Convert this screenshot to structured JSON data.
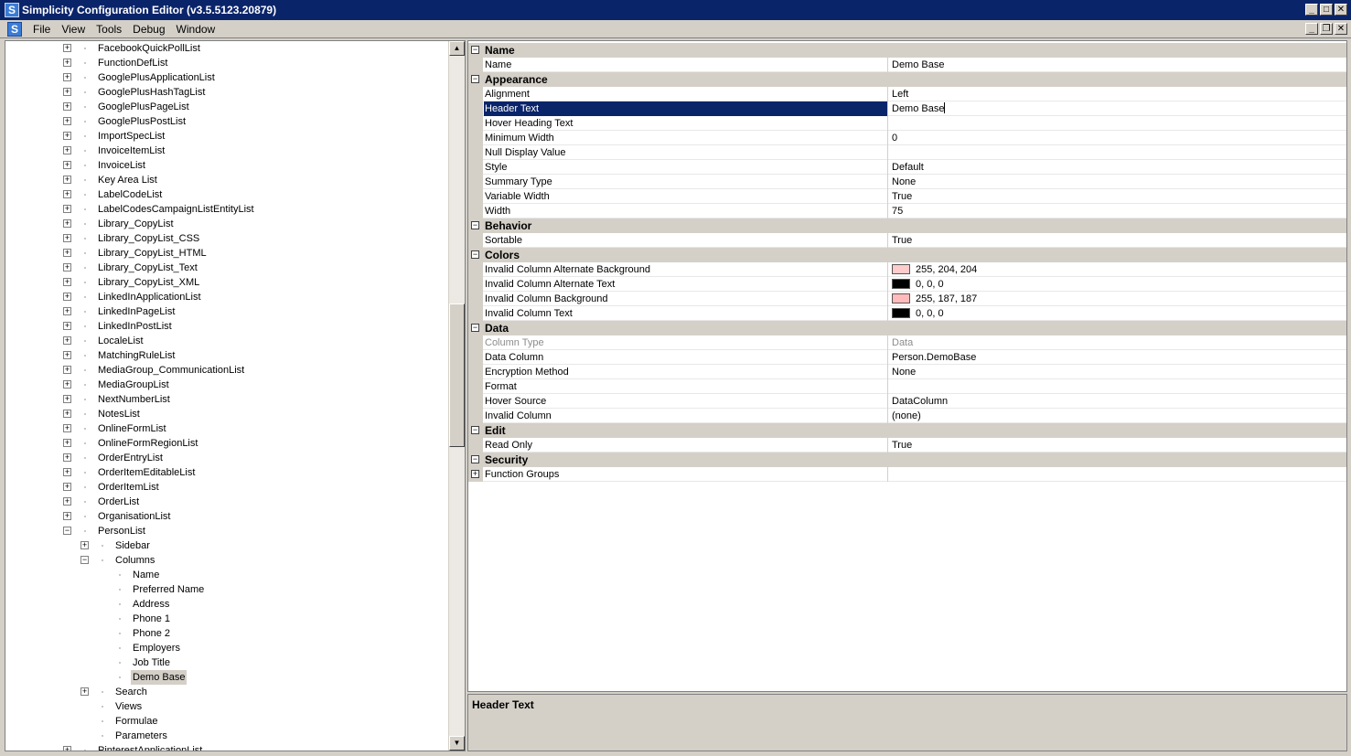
{
  "window": {
    "title": "Simplicity Configuration Editor (v3.5.5123.20879)",
    "app_icon_glyph": "S",
    "controls": [
      "_",
      "□",
      "✕"
    ]
  },
  "menubar": {
    "items": [
      "File",
      "View",
      "Tools",
      "Debug",
      "Window"
    ],
    "mdi_controls": [
      "_",
      "❐",
      "✕"
    ]
  },
  "tree": {
    "items": [
      {
        "label": "FacebookQuickPollList",
        "level": 0,
        "expander": "+"
      },
      {
        "label": "FunctionDefList",
        "level": 0,
        "expander": "+"
      },
      {
        "label": "GooglePlusApplicationList",
        "level": 0,
        "expander": "+"
      },
      {
        "label": "GooglePlusHashTagList",
        "level": 0,
        "expander": "+"
      },
      {
        "label": "GooglePlusPageList",
        "level": 0,
        "expander": "+"
      },
      {
        "label": "GooglePlusPostList",
        "level": 0,
        "expander": "+"
      },
      {
        "label": "ImportSpecList",
        "level": 0,
        "expander": "+"
      },
      {
        "label": "InvoiceItemList",
        "level": 0,
        "expander": "+"
      },
      {
        "label": "InvoiceList",
        "level": 0,
        "expander": "+"
      },
      {
        "label": "Key Area List",
        "level": 0,
        "expander": "+"
      },
      {
        "label": "LabelCodeList",
        "level": 0,
        "expander": "+"
      },
      {
        "label": "LabelCodesCampaignListEntityList",
        "level": 0,
        "expander": "+"
      },
      {
        "label": "Library_CopyList",
        "level": 0,
        "expander": "+"
      },
      {
        "label": "Library_CopyList_CSS",
        "level": 0,
        "expander": "+"
      },
      {
        "label": "Library_CopyList_HTML",
        "level": 0,
        "expander": "+"
      },
      {
        "label": "Library_CopyList_Text",
        "level": 0,
        "expander": "+"
      },
      {
        "label": "Library_CopyList_XML",
        "level": 0,
        "expander": "+"
      },
      {
        "label": "LinkedInApplicationList",
        "level": 0,
        "expander": "+"
      },
      {
        "label": "LinkedInPageList",
        "level": 0,
        "expander": "+"
      },
      {
        "label": "LinkedInPostList",
        "level": 0,
        "expander": "+"
      },
      {
        "label": "LocaleList",
        "level": 0,
        "expander": "+"
      },
      {
        "label": "MatchingRuleList",
        "level": 0,
        "expander": "+"
      },
      {
        "label": "MediaGroup_CommunicationList",
        "level": 0,
        "expander": "+"
      },
      {
        "label": "MediaGroupList",
        "level": 0,
        "expander": "+"
      },
      {
        "label": "NextNumberList",
        "level": 0,
        "expander": "+"
      },
      {
        "label": "NotesList",
        "level": 0,
        "expander": "+"
      },
      {
        "label": "OnlineFormList",
        "level": 0,
        "expander": "+"
      },
      {
        "label": "OnlineFormRegionList",
        "level": 0,
        "expander": "+"
      },
      {
        "label": "OrderEntryList",
        "level": 0,
        "expander": "+"
      },
      {
        "label": "OrderItemEditableList",
        "level": 0,
        "expander": "+"
      },
      {
        "label": "OrderItemList",
        "level": 0,
        "expander": "+"
      },
      {
        "label": "OrderList",
        "level": 0,
        "expander": "+"
      },
      {
        "label": "OrganisationList",
        "level": 0,
        "expander": "+"
      },
      {
        "label": "PersonList",
        "level": 0,
        "expander": "−"
      },
      {
        "label": "Sidebar",
        "level": 1,
        "expander": "+"
      },
      {
        "label": "Columns",
        "level": 1,
        "expander": "−"
      },
      {
        "label": "Name",
        "level": 2,
        "expander": ""
      },
      {
        "label": "Preferred Name",
        "level": 2,
        "expander": ""
      },
      {
        "label": "Address",
        "level": 2,
        "expander": ""
      },
      {
        "label": "Phone 1",
        "level": 2,
        "expander": ""
      },
      {
        "label": "Phone 2",
        "level": 2,
        "expander": ""
      },
      {
        "label": "Employers",
        "level": 2,
        "expander": ""
      },
      {
        "label": "Job Title",
        "level": 2,
        "expander": ""
      },
      {
        "label": "Demo Base",
        "level": 2,
        "expander": "",
        "selected": true
      },
      {
        "label": "Search",
        "level": 1,
        "expander": "+"
      },
      {
        "label": "Views",
        "level": 1,
        "expander": ""
      },
      {
        "label": "Formulae",
        "level": 1,
        "expander": ""
      },
      {
        "label": "Parameters",
        "level": 1,
        "expander": ""
      },
      {
        "label": "PinterestApplicationList",
        "level": 0,
        "expander": "+"
      }
    ]
  },
  "properties": {
    "rows": [
      {
        "type": "cat",
        "label": "Name"
      },
      {
        "type": "item",
        "label": "Name",
        "value": "Demo Base"
      },
      {
        "type": "cat",
        "label": "Appearance"
      },
      {
        "type": "item",
        "label": "Alignment",
        "value": "Left"
      },
      {
        "type": "item",
        "label": "Header Text",
        "value": "Demo Base",
        "selected": true
      },
      {
        "type": "item",
        "label": "Hover Heading Text",
        "value": ""
      },
      {
        "type": "item",
        "label": "Minimum Width",
        "value": "0"
      },
      {
        "type": "item",
        "label": "Null Display Value",
        "value": ""
      },
      {
        "type": "item",
        "label": "Style",
        "value": "Default"
      },
      {
        "type": "item",
        "label": "Summary Type",
        "value": "None"
      },
      {
        "type": "item",
        "label": "Variable Width",
        "value": "True"
      },
      {
        "type": "item",
        "label": "Width",
        "value": "75"
      },
      {
        "type": "cat",
        "label": "Behavior"
      },
      {
        "type": "item",
        "label": "Sortable",
        "value": "True"
      },
      {
        "type": "cat",
        "label": "Colors"
      },
      {
        "type": "item",
        "label": "Invalid Column Alternate Background",
        "value": "255, 204, 204",
        "swatch": "#ffcccc"
      },
      {
        "type": "item",
        "label": "Invalid Column Alternate Text",
        "value": "0, 0, 0",
        "swatch": "#000000"
      },
      {
        "type": "item",
        "label": "Invalid Column Background",
        "value": "255, 187, 187",
        "swatch": "#ffbbbb"
      },
      {
        "type": "item",
        "label": "Invalid Column Text",
        "value": "0, 0, 0",
        "swatch": "#000000"
      },
      {
        "type": "cat",
        "label": "Data"
      },
      {
        "type": "item",
        "label": "Column Type",
        "value": "Data",
        "disabled": true
      },
      {
        "type": "item",
        "label": "Data Column",
        "value": "Person.DemoBase"
      },
      {
        "type": "item",
        "label": "Encryption Method",
        "value": "None"
      },
      {
        "type": "item",
        "label": "Format",
        "value": ""
      },
      {
        "type": "item",
        "label": "Hover Source",
        "value": "DataColumn"
      },
      {
        "type": "item",
        "label": "Invalid Column",
        "value": "(none)"
      },
      {
        "type": "cat",
        "label": "Edit"
      },
      {
        "type": "item",
        "label": "Read Only",
        "value": "True"
      },
      {
        "type": "cat",
        "label": "Security"
      },
      {
        "type": "item",
        "label": "Function Groups",
        "value": "",
        "expandable": true
      }
    ]
  },
  "help": {
    "title": "Header Text"
  }
}
